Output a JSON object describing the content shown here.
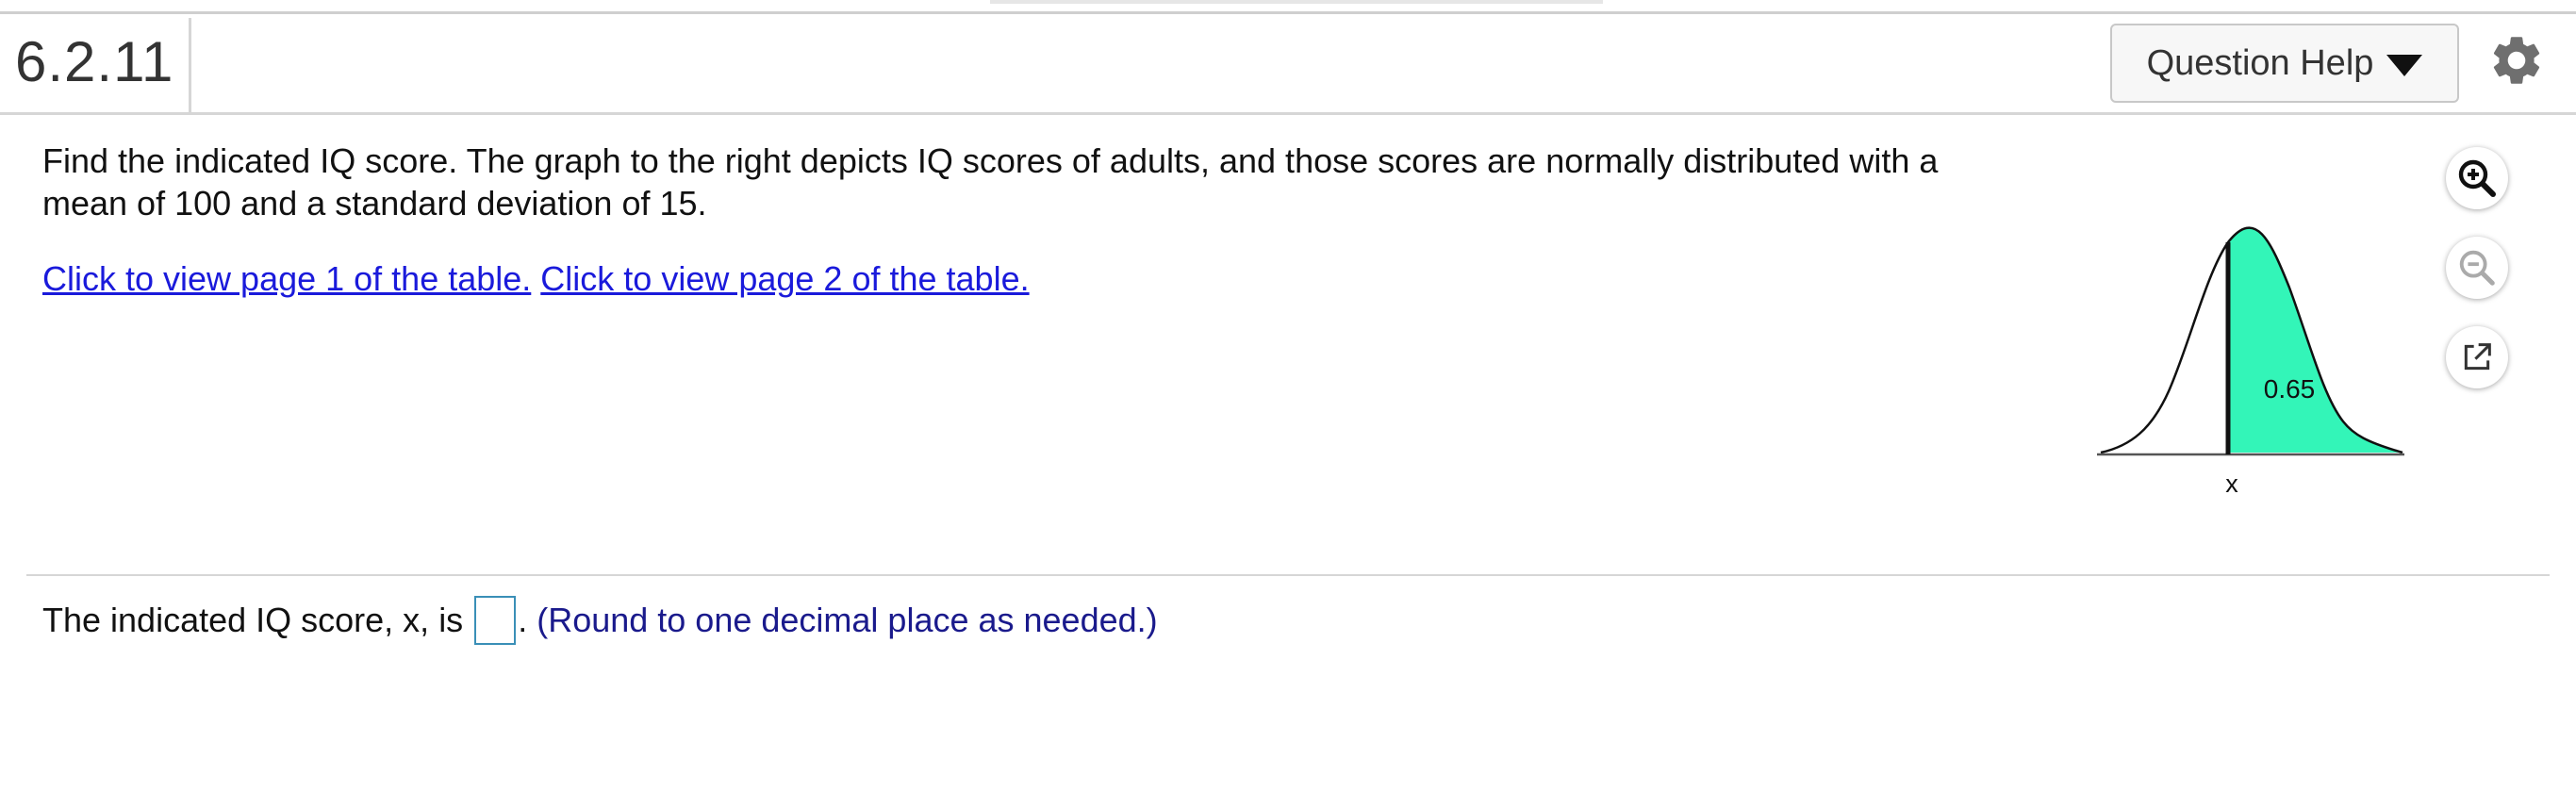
{
  "header": {
    "question_number": "6.2.11",
    "help_button_label": "Question Help",
    "help_icon": "caret-down-icon",
    "settings_icon": "gear-icon"
  },
  "problem": {
    "text": "Find the indicated IQ score. The graph to the right depicts IQ scores of adults, and those scores are normally distributed with a mean of 100 and a standard deviation of 15.",
    "links": [
      {
        "label": "Click to view page 1 of the table."
      },
      {
        "label": "Click to view page 2 of the table."
      }
    ]
  },
  "graph": {
    "shaded_area_label": "0.65",
    "x_label": "x",
    "shade_color": "#33f5b8"
  },
  "tools": [
    {
      "icon": "zoom-in-icon"
    },
    {
      "icon": "zoom-out-icon"
    },
    {
      "icon": "external-link-icon"
    }
  ],
  "answer": {
    "prefix": "The indicated IQ score, x, is",
    "input_value": "",
    "period": ".",
    "hint": "(Round to one decimal place as needed.)"
  }
}
